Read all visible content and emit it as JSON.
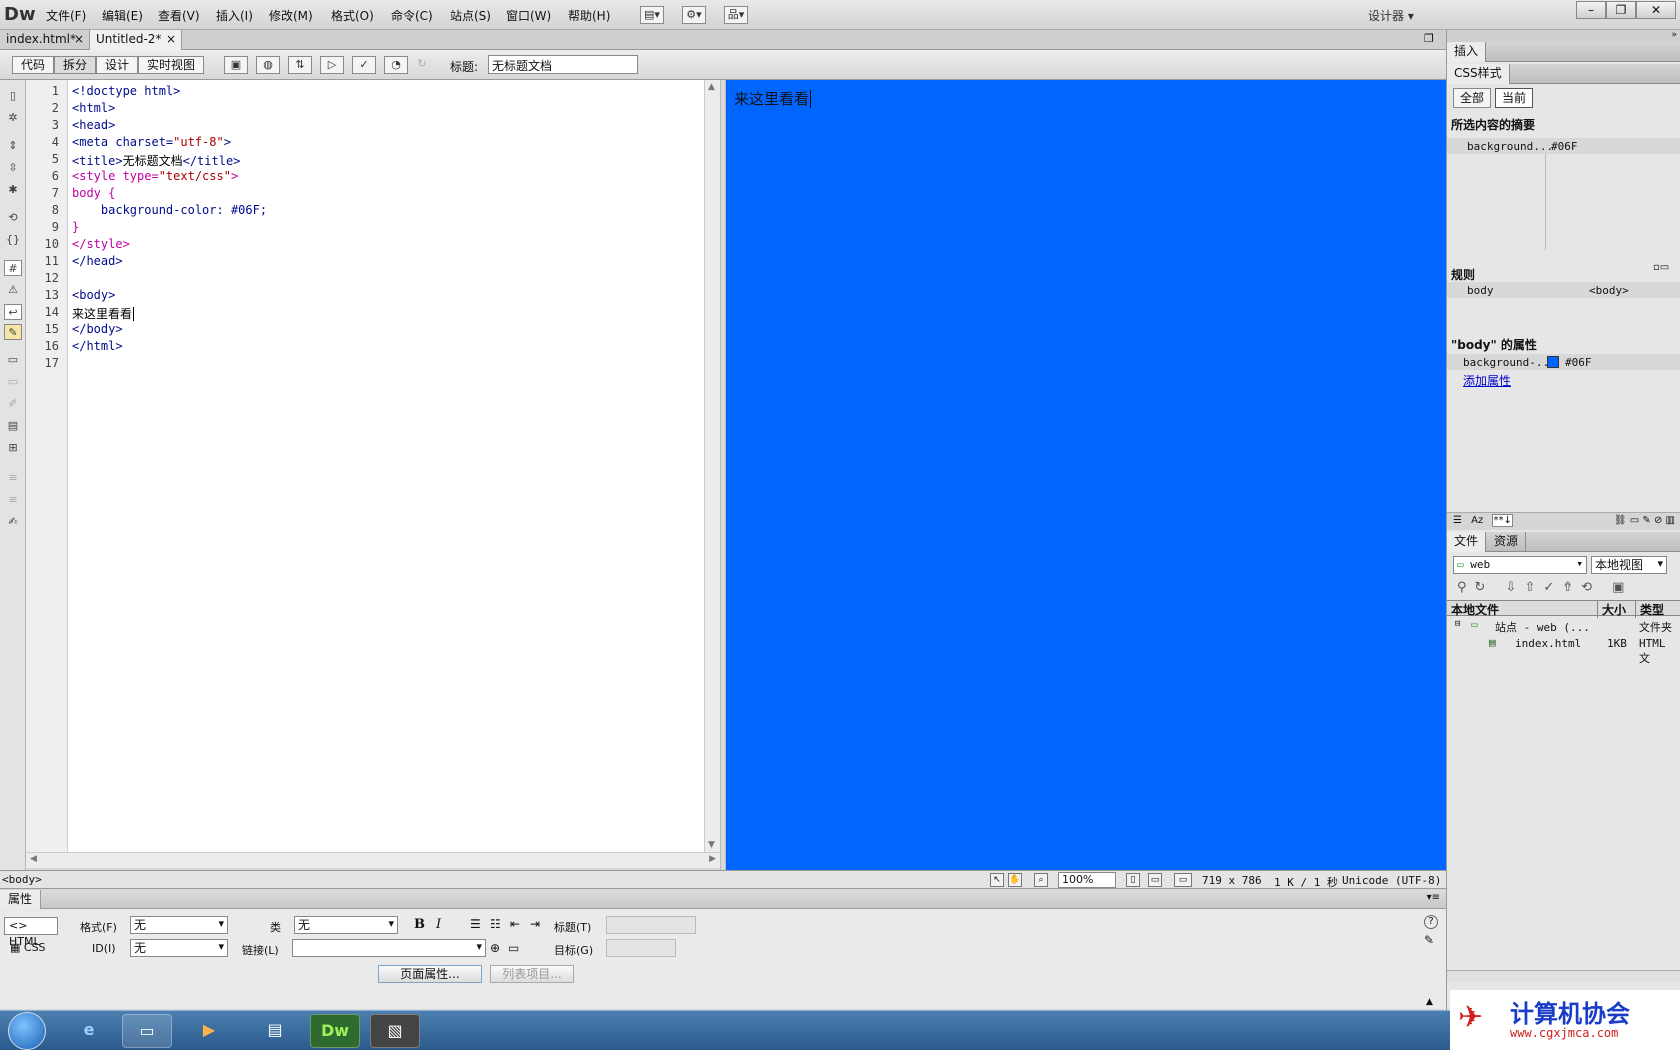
{
  "app": {
    "logo": "Dw",
    "workspace": "设计器 ▾"
  },
  "menu": [
    "文件(F)",
    "编辑(E)",
    "查看(V)",
    "插入(I)",
    "修改(M)",
    "格式(O)",
    "命令(C)",
    "站点(S)",
    "窗口(W)",
    "帮助(H)"
  ],
  "window_buttons": {
    "minimize": "–",
    "restore": "❐",
    "close": "✕"
  },
  "doc_tabs": [
    {
      "label": "index.html*",
      "close": "×"
    },
    {
      "label": "Untitled-2*",
      "close": "×"
    }
  ],
  "doc_toolbar": {
    "views": [
      "代码",
      "拆分",
      "设计",
      "实时视图"
    ],
    "title_label": "标题:",
    "title_value": "无标题文档"
  },
  "code": {
    "line_numbers": [
      "1",
      "2",
      "3",
      "4",
      "5",
      "6",
      "7",
      "8",
      "9",
      "10",
      "11",
      "12",
      "13",
      "14",
      "15",
      "16",
      "17"
    ],
    "l1": "<!doctype html>",
    "l2": "<html>",
    "l3": "<head>",
    "l4a": "<meta charset=",
    "l4b": "\"utf-8\"",
    "l4c": ">",
    "l5a": "<title>",
    "l5b": "无标题文档",
    "l5c": "</title>",
    "l6a": "<style type=",
    "l6b": "\"text/css\"",
    "l6c": ">",
    "l7": "body {",
    "l8": "    background-color: #06F;",
    "l9": "}",
    "l10": "</style>",
    "l11": "</head>",
    "l13": "<body>",
    "l14": "来这里看看",
    "l15": "</body>",
    "l16": "</html>"
  },
  "design_view": {
    "text": "来这里看看",
    "background": "#0066ff"
  },
  "status": {
    "tag_selector": "<body>",
    "zoom": "100%",
    "dimensions": "719 x 786",
    "download": "1 K / 1 秒",
    "encoding": "Unicode (UTF-8)"
  },
  "properties": {
    "tab": "属性",
    "html_btn": "HTML",
    "css_btn": "CSS",
    "format_label": "格式(F)",
    "format_value": "无",
    "id_label": "ID(I)",
    "id_value": "无",
    "class_label": "类",
    "class_value": "无",
    "link_label": "链接(L)",
    "link_value": "",
    "bold": "B",
    "italic": "I",
    "title_label": "标题(T)",
    "target_label": "目标(G)",
    "page_props_btn": "页面属性...",
    "list_item_btn": "列表项目..."
  },
  "right_panel": {
    "insert_tab": "插入",
    "css_tab": "CSS样式",
    "all_btn": "全部",
    "current_btn": "当前",
    "summary_title": "所选内容的摘要",
    "summary_row": {
      "prop": "background...",
      "value": "#06F"
    },
    "rules_title": "规则",
    "rules_row": {
      "name": "body",
      "tag": "<body>"
    },
    "props_title": "\"body\" 的属性",
    "props_row": {
      "prop": "background-...",
      "value": "#06F",
      "swatch": "#0066ff"
    },
    "add_prop": "添加属性",
    "files_tab": "文件",
    "assets_tab": "资源",
    "site_select": "web",
    "view_select": "本地视图",
    "col_local": "本地文件",
    "col_size": "大小",
    "col_type": "类型",
    "site_row": {
      "name": "站点 - web (...",
      "type": "文件夹"
    },
    "file_row": {
      "name": "index.html",
      "size": "1KB",
      "type": "HTML 文"
    }
  },
  "watermark": {
    "title": "计算机协会",
    "url": "www.cgxjmca.com"
  },
  "colors": {
    "accent": "#0066ff",
    "taskbar": "#2b5a8c"
  }
}
